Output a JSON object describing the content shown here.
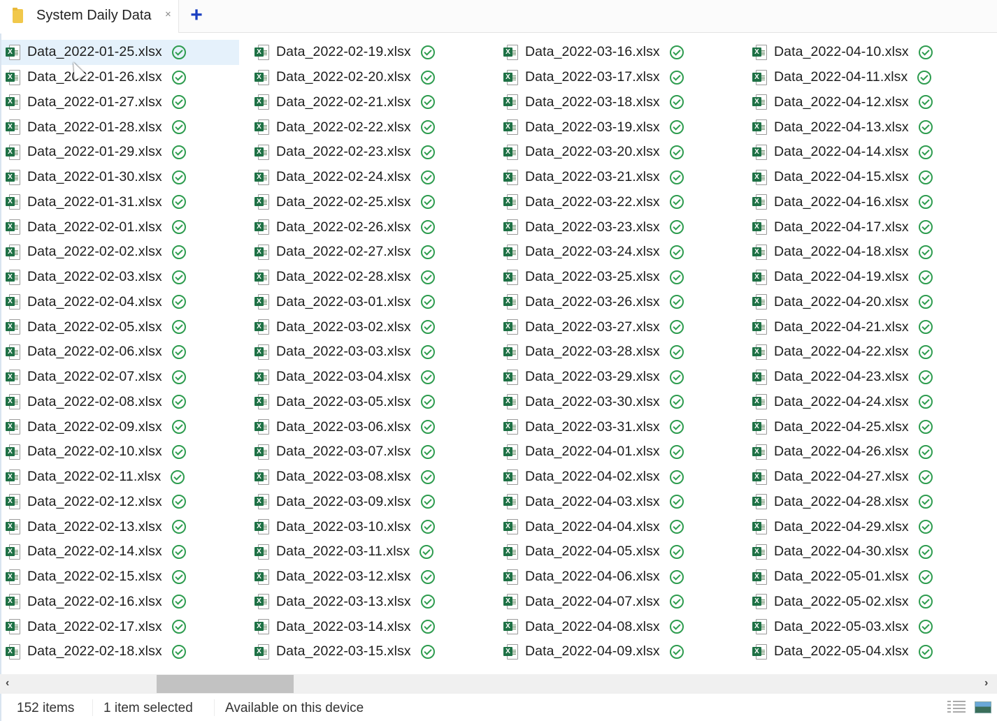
{
  "tab": {
    "title": "System Daily Data",
    "close_icon": "×",
    "new_tab_icon": "+",
    "folder_icon": "folder-icon"
  },
  "files": {
    "file_icon": "excel-file-icon",
    "file_icon_badge": "X",
    "status_icon": "available-check-icon",
    "selected_index": 0,
    "columns": [
      [
        "Data_2022-01-25.xlsx",
        "Data_2022-01-26.xlsx",
        "Data_2022-01-27.xlsx",
        "Data_2022-01-28.xlsx",
        "Data_2022-01-29.xlsx",
        "Data_2022-01-30.xlsx",
        "Data_2022-01-31.xlsx",
        "Data_2022-02-01.xlsx",
        "Data_2022-02-02.xlsx",
        "Data_2022-02-03.xlsx",
        "Data_2022-02-04.xlsx",
        "Data_2022-02-05.xlsx",
        "Data_2022-02-06.xlsx",
        "Data_2022-02-07.xlsx",
        "Data_2022-02-08.xlsx",
        "Data_2022-02-09.xlsx",
        "Data_2022-02-10.xlsx",
        "Data_2022-02-11.xlsx",
        "Data_2022-02-12.xlsx",
        "Data_2022-02-13.xlsx",
        "Data_2022-02-14.xlsx",
        "Data_2022-02-15.xlsx",
        "Data_2022-02-16.xlsx",
        "Data_2022-02-17.xlsx",
        "Data_2022-02-18.xlsx"
      ],
      [
        "Data_2022-02-19.xlsx",
        "Data_2022-02-20.xlsx",
        "Data_2022-02-21.xlsx",
        "Data_2022-02-22.xlsx",
        "Data_2022-02-23.xlsx",
        "Data_2022-02-24.xlsx",
        "Data_2022-02-25.xlsx",
        "Data_2022-02-26.xlsx",
        "Data_2022-02-27.xlsx",
        "Data_2022-02-28.xlsx",
        "Data_2022-03-01.xlsx",
        "Data_2022-03-02.xlsx",
        "Data_2022-03-03.xlsx",
        "Data_2022-03-04.xlsx",
        "Data_2022-03-05.xlsx",
        "Data_2022-03-06.xlsx",
        "Data_2022-03-07.xlsx",
        "Data_2022-03-08.xlsx",
        "Data_2022-03-09.xlsx",
        "Data_2022-03-10.xlsx",
        "Data_2022-03-11.xlsx",
        "Data_2022-03-12.xlsx",
        "Data_2022-03-13.xlsx",
        "Data_2022-03-14.xlsx",
        "Data_2022-03-15.xlsx"
      ],
      [
        "Data_2022-03-16.xlsx",
        "Data_2022-03-17.xlsx",
        "Data_2022-03-18.xlsx",
        "Data_2022-03-19.xlsx",
        "Data_2022-03-20.xlsx",
        "Data_2022-03-21.xlsx",
        "Data_2022-03-22.xlsx",
        "Data_2022-03-23.xlsx",
        "Data_2022-03-24.xlsx",
        "Data_2022-03-25.xlsx",
        "Data_2022-03-26.xlsx",
        "Data_2022-03-27.xlsx",
        "Data_2022-03-28.xlsx",
        "Data_2022-03-29.xlsx",
        "Data_2022-03-30.xlsx",
        "Data_2022-03-31.xlsx",
        "Data_2022-04-01.xlsx",
        "Data_2022-04-02.xlsx",
        "Data_2022-04-03.xlsx",
        "Data_2022-04-04.xlsx",
        "Data_2022-04-05.xlsx",
        "Data_2022-04-06.xlsx",
        "Data_2022-04-07.xlsx",
        "Data_2022-04-08.xlsx",
        "Data_2022-04-09.xlsx"
      ],
      [
        "Data_2022-04-10.xlsx",
        "Data_2022-04-11.xlsx",
        "Data_2022-04-12.xlsx",
        "Data_2022-04-13.xlsx",
        "Data_2022-04-14.xlsx",
        "Data_2022-04-15.xlsx",
        "Data_2022-04-16.xlsx",
        "Data_2022-04-17.xlsx",
        "Data_2022-04-18.xlsx",
        "Data_2022-04-19.xlsx",
        "Data_2022-04-20.xlsx",
        "Data_2022-04-21.xlsx",
        "Data_2022-04-22.xlsx",
        "Data_2022-04-23.xlsx",
        "Data_2022-04-24.xlsx",
        "Data_2022-04-25.xlsx",
        "Data_2022-04-26.xlsx",
        "Data_2022-04-27.xlsx",
        "Data_2022-04-28.xlsx",
        "Data_2022-04-29.xlsx",
        "Data_2022-04-30.xlsx",
        "Data_2022-05-01.xlsx",
        "Data_2022-05-02.xlsx",
        "Data_2022-05-03.xlsx",
        "Data_2022-05-04.xlsx"
      ]
    ]
  },
  "scrollbar": {
    "left_arrow": "‹",
    "right_arrow": "›"
  },
  "status_bar": {
    "item_count": "152 items",
    "selection": "1 item selected",
    "availability": "Available on this device",
    "details_view_icon": "details-view-icon",
    "tiles_view_icon": "large-icons-view-icon"
  }
}
